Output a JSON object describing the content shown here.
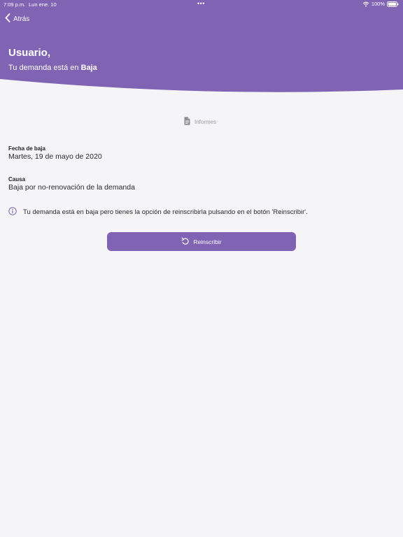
{
  "colors": {
    "header_bg": "#8064b3",
    "page_bg": "#f5f4f7",
    "button_bg": "#8064b3",
    "info_icon": "#7b5fb0",
    "muted": "#9a9a9f"
  },
  "status_bar": {
    "time": "7:09 p.m.",
    "date": "Lun ene. 10",
    "dots": "•••",
    "battery": "100%"
  },
  "header": {
    "back_label": "Atrás",
    "back_icon": "chevron-left-icon",
    "greeting": "Usuario,",
    "status_prefix": "Tu demanda está en ",
    "status_value": "Baja"
  },
  "reports": {
    "icon": "document-icon",
    "label": "Informes"
  },
  "fields": [
    {
      "label": "Fecha de baja",
      "value": "Martes, 19 de mayo de 2020"
    },
    {
      "label": "Causa",
      "value": "Baja por no-renovación de la demanda"
    }
  ],
  "info": {
    "icon": "info-icon",
    "text": "Tu demanda está en baja pero tienes la opción de reinscribirla pulsando en el botón 'Reinscribir'."
  },
  "action": {
    "icon": "refresh-icon",
    "label": "Reinscribir"
  }
}
